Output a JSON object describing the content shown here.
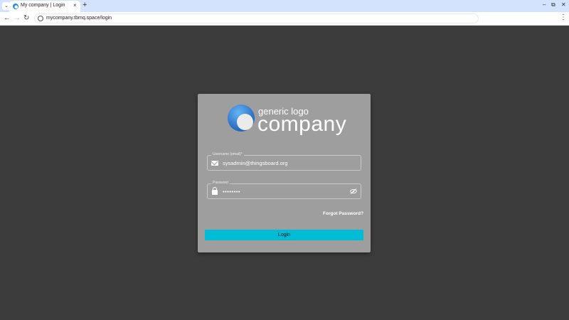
{
  "browser": {
    "tab_title": "My company | Login",
    "tab_close": "×",
    "new_tab": "+",
    "url": "mycompany.tbmq.space/login",
    "nav": {
      "back": "←",
      "forward": "→",
      "reload": "↻"
    },
    "window": {
      "minimize": "–",
      "restore": "⧉",
      "close": "✕"
    },
    "menu": "⋮"
  },
  "logo": {
    "line1": "generic logo",
    "line2": "company"
  },
  "form": {
    "username_label": "Username (email)*",
    "username_value": "sysadmin@thingsboard.org",
    "password_label": "Password",
    "password_value": "••••••••",
    "forgot_label": "Forgot Password?",
    "login_label": "Login"
  },
  "colors": {
    "page_background": "#3c3c3c",
    "card_background": "#9e9e9e",
    "login_button": "#00bcd4",
    "logo_blue": "#1e88e5"
  },
  "icons": {
    "username_field": "mail-icon",
    "password_field": "lock-icon",
    "password_toggle": "eye-off-icon"
  }
}
